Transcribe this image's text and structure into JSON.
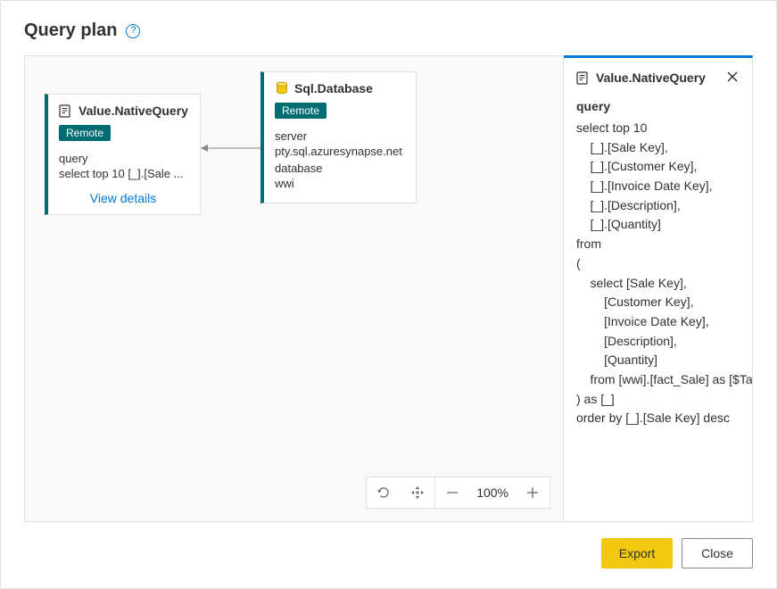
{
  "title": "Query plan",
  "canvas": {
    "nodes": [
      {
        "title": "Value.NativeQuery",
        "badge": "Remote",
        "field1_label": "query",
        "field1_value": "select top 10 [_].[Sale ...",
        "view_details": "View details"
      },
      {
        "title": "Sql.Database",
        "badge": "Remote",
        "field1_label": "server",
        "field1_value": "pty.sql.azuresynapse.net",
        "field2_label": "database",
        "field2_value": "wwi"
      }
    ],
    "zoom": "100%"
  },
  "detail": {
    "title": "Value.NativeQuery",
    "label": "query",
    "query": "select top 10\n    [_].[Sale Key],\n    [_].[Customer Key],\n    [_].[Invoice Date Key],\n    [_].[Description],\n    [_].[Quantity]\nfrom\n(\n    select [Sale Key],\n        [Customer Key],\n        [Invoice Date Key],\n        [Description],\n        [Quantity]\n    from [wwi].[fact_Sale] as [$Table]\n) as [_]\norder by [_].[Sale Key] desc"
  },
  "footer": {
    "export": "Export",
    "close": "Close"
  }
}
